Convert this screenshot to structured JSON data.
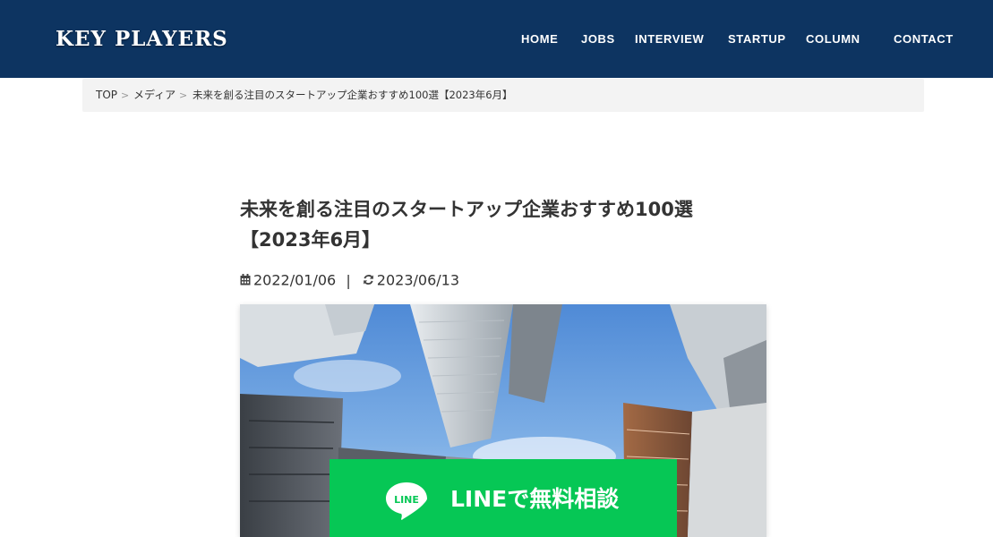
{
  "header": {
    "logo": "KEY PLAYERS",
    "nav": [
      "HOME",
      "JOBS",
      "INTERVIEW",
      "STARTUP",
      "COLUMN",
      "CONTACT"
    ]
  },
  "breadcrumb": {
    "items": [
      "TOP",
      "メディア",
      "未来を創る注目のスタートアップ企業おすすめ100選【2023年6月】"
    ],
    "separator": ">"
  },
  "article": {
    "title_line1": "未来を創る注目のスタートアップ企業おすすめ100選",
    "title_line2": "【2023年6月】",
    "published": "2022/01/06",
    "meta_separator": "|",
    "updated": "2023/06/13",
    "hero_image": "skyscrapers-looking-up-blue-sky"
  },
  "line_cta": {
    "badge_text": "LINE",
    "label": "LINEで無料相談",
    "color": "#06c755"
  },
  "colors": {
    "header_bg": "#0d3461",
    "breadcrumb_bg": "#f3f3f3"
  }
}
